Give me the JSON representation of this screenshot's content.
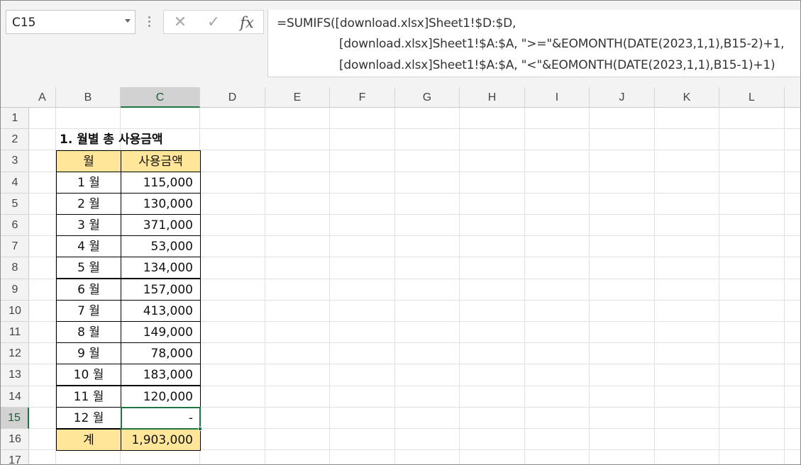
{
  "name_box": {
    "value": "C15"
  },
  "formula_bar": {
    "lines": [
      "=SUMIFS([download.xlsx]Sheet1!$D:$D,",
      "[download.xlsx]Sheet1!$A:$A, \">=\"&EOMONTH(DATE(2023,1,1),B15-2)+1,",
      "[download.xlsx]Sheet1!$A:$A, \"<\"&EOMONTH(DATE(2023,1,1),B15-1)+1)"
    ],
    "cancel_glyph": "✕",
    "enter_glyph": "✓",
    "fx_glyph": "fx"
  },
  "columns": [
    "A",
    "B",
    "C",
    "D",
    "E",
    "F",
    "G",
    "H",
    "I",
    "J",
    "K",
    "L"
  ],
  "rows": [
    "1",
    "2",
    "3",
    "4",
    "5",
    "6",
    "7",
    "8",
    "9",
    "10",
    "11",
    "12",
    "13",
    "14",
    "15",
    "16",
    "17"
  ],
  "selected": {
    "column": "C",
    "row": "15"
  },
  "sheet": {
    "title": "1. 월별 총 사용금액",
    "header": {
      "month": "월",
      "amount": "사용금액"
    },
    "data": [
      {
        "month": "1 월",
        "amount": "115,000"
      },
      {
        "month": "2 월",
        "amount": "130,000"
      },
      {
        "month": "3 월",
        "amount": "371,000"
      },
      {
        "month": "4 월",
        "amount": "53,000"
      },
      {
        "month": "5 월",
        "amount": "134,000"
      },
      {
        "month": "6 월",
        "amount": "157,000"
      },
      {
        "month": "7 월",
        "amount": "413,000"
      },
      {
        "month": "8 월",
        "amount": "149,000"
      },
      {
        "month": "9 월",
        "amount": "78,000"
      },
      {
        "month": "10 월",
        "amount": "183,000"
      },
      {
        "month": "11 월",
        "amount": "120,000"
      },
      {
        "month": "12 월",
        "amount": "-"
      }
    ],
    "total": {
      "label": "계",
      "amount": "1,903,000"
    }
  },
  "colors": {
    "header_fill": "#ffe699",
    "selection": "#217346"
  }
}
